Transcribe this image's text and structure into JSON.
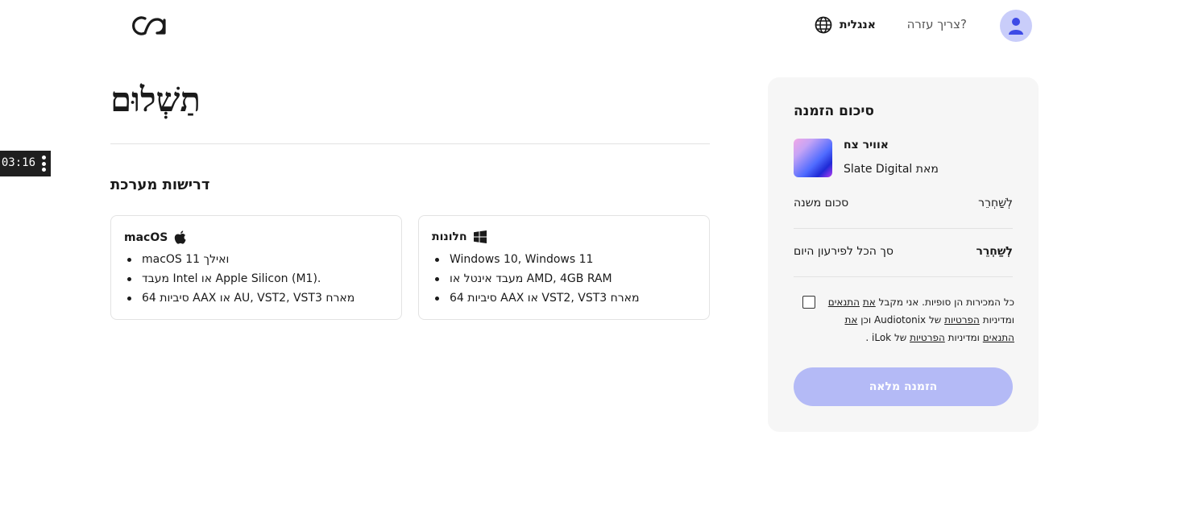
{
  "header": {
    "help_label": "צריך עזרה?",
    "language_label": "אנגלית"
  },
  "timer": {
    "text": ":03:16"
  },
  "main": {
    "title": "תַשְׁלוּם",
    "system_requirements_title": "דרישות מערכת",
    "windows": {
      "name": "חלונות",
      "items": [
        "Windows 10, Windows 11",
        "מעבד אינטל או AMD, 4GB RAM",
        "סיביות 64 AAX או VST2, VST3 מארח"
      ]
    },
    "mac": {
      "name": "macOS",
      "items": [
        "macOS 11 ואילך",
        "מעבד Intel או Apple Silicon (M1).",
        "סיביות 64 AAX או AU, VST2, VST3 מארח"
      ]
    }
  },
  "summary": {
    "title": "סיכום הזמנה",
    "product_name": "אוויר צח",
    "product_by": "מאת Slate Digital",
    "subtotal_label": "סכום משנה",
    "subtotal_value": "לְשַׁחְרֵר",
    "total_label": "סך הכל לפירעון היום",
    "total_value": "לְשַׁחְרֵר",
    "terms": {
      "part1": "כל המכירות הן סופיות. אני מקבל",
      "link1": "את",
      "link2": "התנאים",
      "part2": "ומדיניות",
      "link3": "הפרטיות",
      "part3": "של Audiotonix",
      "part4": "וכן",
      "link4": "את התנאים",
      "part5": "ומדיניות",
      "link5": "הפרטיות",
      "part6": "של iLok ."
    },
    "submit_label": "הזמנה מלאה"
  },
  "colors": {
    "accent": "#b4baf6",
    "avatar_bg": "#c9cdfa",
    "avatar_icon": "#3d4ae6",
    "panel_bg": "#f6f6f6"
  },
  "icons": [
    "logo-icon",
    "user-icon",
    "globe-icon",
    "windows-icon",
    "apple-icon",
    "more-vertical-icon"
  ]
}
